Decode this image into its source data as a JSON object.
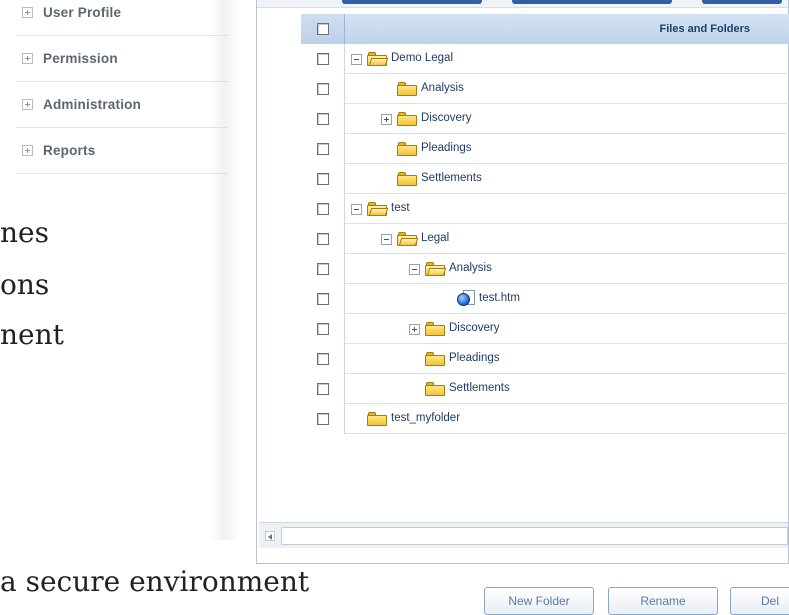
{
  "sidebar": {
    "items": [
      {
        "label": "User Profile"
      },
      {
        "label": "Permission"
      },
      {
        "label": "Administration"
      },
      {
        "label": "Reports"
      }
    ]
  },
  "background_text": {
    "line1": "nes",
    "line2": "ons",
    "line3": "nent",
    "line4": "a secure environment"
  },
  "grid": {
    "header": "Files and Folders",
    "rows": [
      {
        "label": "Demo Legal",
        "type": "folder",
        "toggle": "minus",
        "level": 0
      },
      {
        "label": "Analysis",
        "type": "folder",
        "toggle": "none",
        "level": 1
      },
      {
        "label": "Discovery",
        "type": "folder",
        "toggle": "plus",
        "level": 1
      },
      {
        "label": "Pleadings",
        "type": "folder",
        "toggle": "none",
        "level": 1
      },
      {
        "label": "Settlements",
        "type": "folder",
        "toggle": "none",
        "level": 1
      },
      {
        "label": "test",
        "type": "folder",
        "toggle": "minus",
        "level": 0
      },
      {
        "label": "Legal",
        "type": "folder",
        "toggle": "minus",
        "level": 1
      },
      {
        "label": "Analysis",
        "type": "folder",
        "toggle": "minus",
        "level": 2
      },
      {
        "label": "test.htm",
        "type": "file",
        "toggle": "none",
        "level": 3
      },
      {
        "label": "Discovery",
        "type": "folder",
        "toggle": "plus",
        "level": 2
      },
      {
        "label": "Pleadings",
        "type": "folder",
        "toggle": "none",
        "level": 2
      },
      {
        "label": "Settlements",
        "type": "folder",
        "toggle": "none",
        "level": 2
      },
      {
        "label": "test_myfolder",
        "type": "folder",
        "toggle": "none",
        "level": 0
      }
    ]
  },
  "buttons": {
    "new_folder": "New Folder",
    "rename": "Rename",
    "delete": "Del"
  }
}
